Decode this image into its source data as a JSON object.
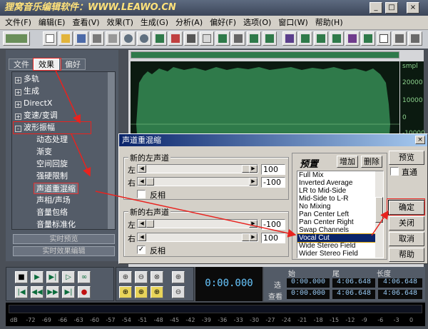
{
  "app": {
    "title": "狸窝音乐编辑软件：WWW.LEAWO.CN",
    "window_buttons": [
      "_",
      "□",
      "×"
    ]
  },
  "menu": {
    "items": [
      "文件(F)",
      "编辑(E)",
      "查看(V)",
      "效果(T)",
      "生成(G)",
      "分析(A)",
      "偏好(F)",
      "选项(O)",
      "窗口(W)",
      "帮助(H)"
    ]
  },
  "left_panel": {
    "tabs": [
      "文件",
      "效果",
      "偏好"
    ],
    "active_tab": "效果",
    "tree": [
      {
        "label": "多轨",
        "expander": "+",
        "indent": 0
      },
      {
        "label": "生成",
        "expander": "+",
        "indent": 0
      },
      {
        "label": "DirectX",
        "expander": "+",
        "indent": 0
      },
      {
        "label": "变速/变调",
        "expander": "+",
        "indent": 0
      },
      {
        "label": "波形振幅",
        "expander": "-",
        "indent": 0
      },
      {
        "label": "动态处理",
        "indent": 1
      },
      {
        "label": "渐变",
        "indent": 1
      },
      {
        "label": "空间回旋",
        "indent": 1
      },
      {
        "label": "强硬限制",
        "indent": 1
      },
      {
        "label": "声道重混缩",
        "indent": 1
      },
      {
        "label": "声相/声场",
        "indent": 1
      },
      {
        "label": "音量包络",
        "indent": 1
      },
      {
        "label": "音量标准化",
        "indent": 1
      }
    ],
    "bottom_buttons": [
      "实时预览",
      "实时效果编辑"
    ]
  },
  "waveform": {
    "scale_label": "smpl",
    "scale_ticks": [
      "20000",
      "10000",
      "0",
      "-10000"
    ]
  },
  "dialog": {
    "title": "声道重混缩",
    "close_label": "×",
    "left_group": {
      "legend": "新的左声道",
      "left_label": "左",
      "left_value": "100",
      "right_label": "右",
      "right_value": "-100",
      "invert_label": "反相",
      "invert_checked": false
    },
    "right_group": {
      "legend": "新的右声道",
      "left_label": "左",
      "left_value": "-100",
      "right_label": "右",
      "right_value": "100",
      "invert_label": "反相",
      "invert_checked": true
    },
    "presets": {
      "title": "预置",
      "add_label": "增加",
      "delete_label": "删除",
      "items": [
        "Full Mix",
        "Inverted Average",
        "LR to Mid-Side",
        "Mid-Side to L-R",
        "No Mixing",
        "Pan Center Left",
        "Pan Center Right",
        "Swap Channels",
        "Vocal Cut",
        "Wide Stereo Field",
        "Wider Stereo Field"
      ],
      "selected": "Vocal Cut"
    },
    "buttons": {
      "preview": "预览",
      "bypass": "直通",
      "ok": "确定",
      "close": "关闭",
      "cancel": "取消",
      "help": "帮助"
    }
  },
  "transport": {
    "time": "0:00.000"
  },
  "time_table": {
    "headers": [
      "始",
      "尾",
      "长度"
    ],
    "rows": [
      {
        "label": "选",
        "values": [
          "0:00.000",
          "4:06.648",
          "4:06.648"
        ]
      },
      {
        "label": "查看",
        "values": [
          "0:00.000",
          "4:06.648",
          "4:06.648"
        ]
      }
    ]
  },
  "levels": {
    "ticks": [
      "dB",
      "-72",
      "-69",
      "-66",
      "-63",
      "-60",
      "-57",
      "-54",
      "-51",
      "-48",
      "-45",
      "-42",
      "-39",
      "-36",
      "-33",
      "-30",
      "-27",
      "-24",
      "-21",
      "-18",
      "-15",
      "-12",
      "-9",
      "-6",
      "-3",
      "0"
    ]
  },
  "colors": {
    "highlight": "#e8231f",
    "wave": "#2f7a4a",
    "selection": "#0a246a"
  }
}
